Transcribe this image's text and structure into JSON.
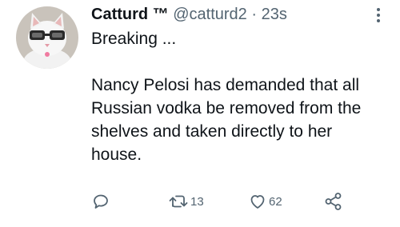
{
  "tweet": {
    "author_name": "Catturd ™",
    "handle": "@catturd2",
    "separator": "·",
    "time": "23s",
    "text_line1": "Breaking ...",
    "text_line2": "Nancy Pelosi has demanded that all Russian vodka be removed from the shelves and taken directly to her house."
  },
  "actions": {
    "reply_icon": "reply-icon",
    "retweet_icon": "retweet-icon",
    "retweet_count": "13",
    "like_icon": "heart-icon",
    "like_count": "62",
    "share_icon": "share-icon"
  },
  "colors": {
    "text": "#0f1419",
    "muted": "#536471",
    "background": "#ffffff"
  }
}
